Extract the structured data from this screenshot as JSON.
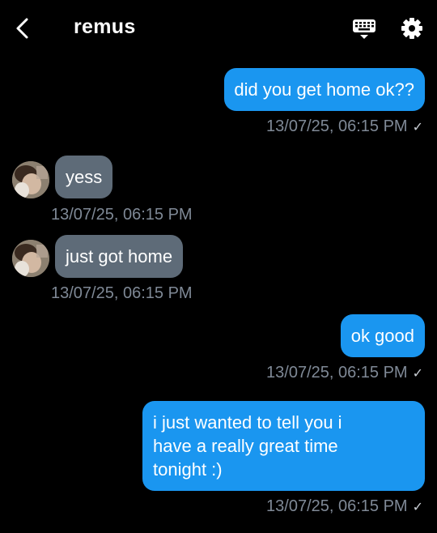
{
  "header": {
    "title": "remus",
    "back_icon": "chevron-left-icon",
    "keyboard_icon": "keyboard-icon",
    "settings_icon": "gear-icon"
  },
  "colors": {
    "background": "#000000",
    "outgoing_bubble": "#1a96f0",
    "incoming_bubble": "#5e6b78",
    "timestamp": "#7f8996"
  },
  "messages": [
    {
      "direction": "outgoing",
      "text": "did you get home ok??",
      "timestamp": "13/07/25, 06:15 PM",
      "status": "✓"
    },
    {
      "direction": "incoming",
      "text": "yess",
      "timestamp": "13/07/25, 06:15 PM"
    },
    {
      "direction": "incoming",
      "text": "just got home",
      "timestamp": "13/07/25, 06:15 PM"
    },
    {
      "direction": "outgoing",
      "text": "ok good",
      "timestamp": "13/07/25, 06:15 PM",
      "status": "✓"
    },
    {
      "direction": "outgoing",
      "lines": [
        "i just wanted to tell you i",
        "have a really great time",
        "tonight :)"
      ],
      "timestamp": "13/07/25, 06:15 PM",
      "status": "✓"
    }
  ]
}
